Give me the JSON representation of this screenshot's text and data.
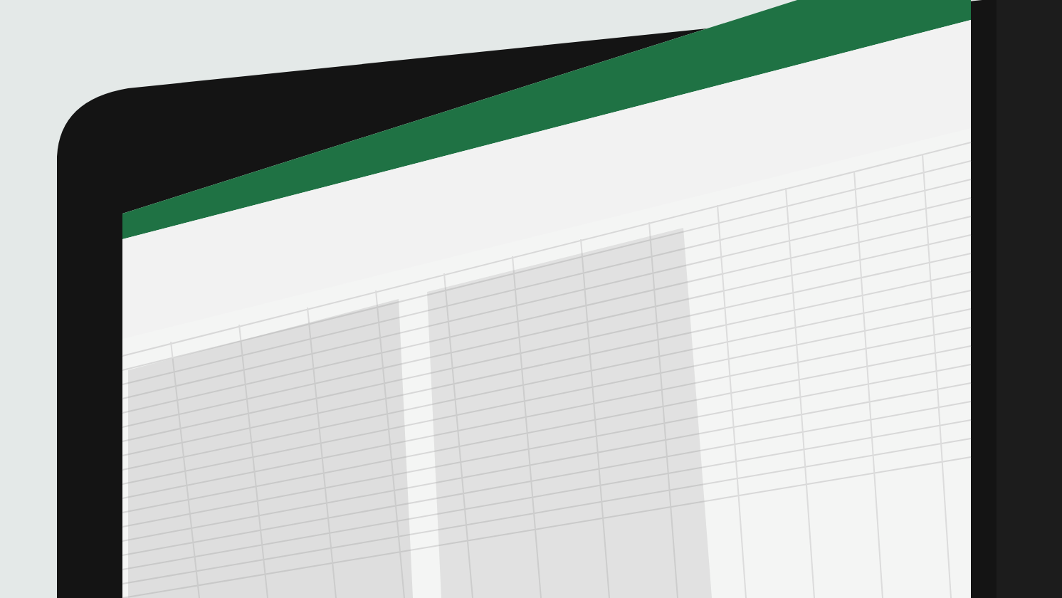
{
  "photo": {
    "kind": "monitor"
  }
}
